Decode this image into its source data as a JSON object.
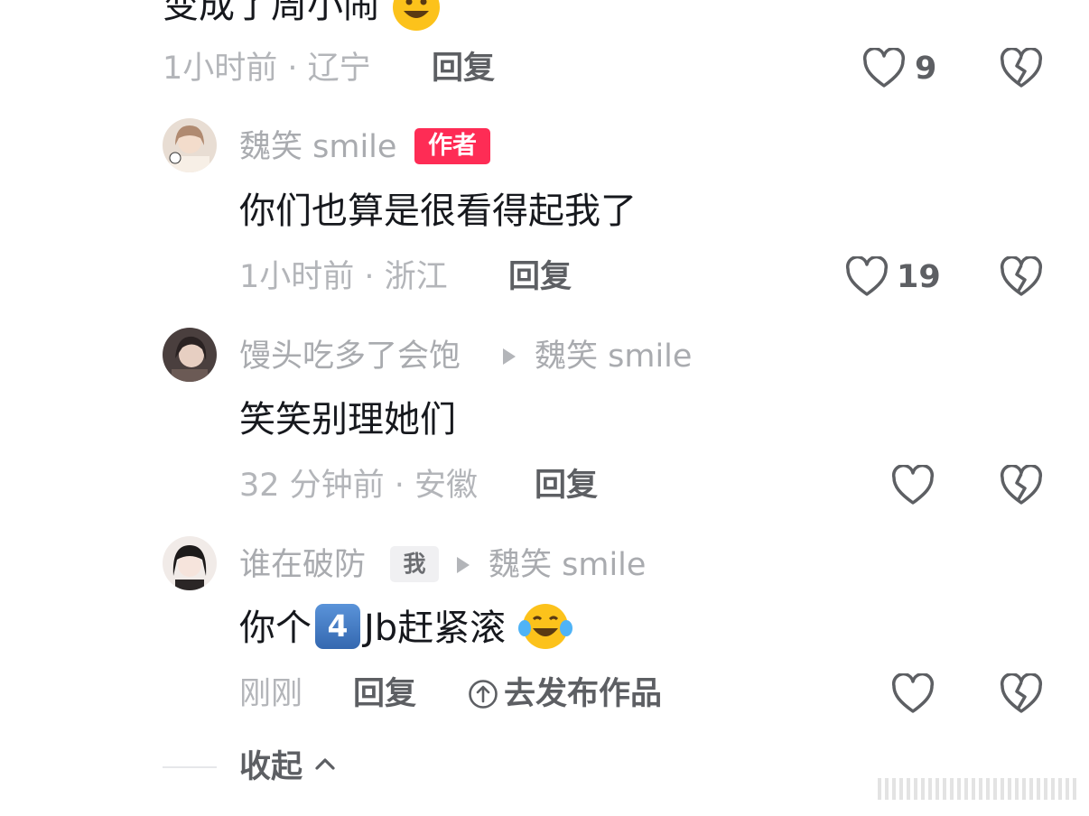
{
  "prev_comment": {
    "text_tail": "变成了周小闹",
    "time_loc": "1小时前 · 辽宁",
    "reply_label": "回复",
    "like_count": "9"
  },
  "comments": [
    {
      "username": "魏笑 smile",
      "badge": "作者",
      "text": "你们也算是很看得起我了",
      "time_loc": "1小时前 · 浙江",
      "reply_label": "回复",
      "like_count": "19"
    },
    {
      "username": "馒头吃多了会饱",
      "reply_to": "魏笑 smile",
      "text": "笑笑别理她们",
      "time_loc": "32 分钟前 · 安徽",
      "reply_label": "回复"
    },
    {
      "username": "谁在破防",
      "badge": "我",
      "reply_to": "魏笑 smile",
      "text_before": "你个",
      "keycap": "4",
      "text_after": "Jb赶紧滚",
      "time_loc": "刚刚",
      "reply_label": "回复",
      "publish_label": "去发布作品"
    }
  ],
  "collapse_label": "收起",
  "colors": {
    "author_badge": "#fe2c55",
    "meta_text": "#b3b5b9",
    "primary_text": "#16181d",
    "action_text": "#5d5f63"
  },
  "icons": [
    "heart-outline-icon",
    "broken-heart-icon",
    "play-triangle-icon",
    "upload-circle-icon",
    "chevron-up-icon",
    "grinning-emoji-icon",
    "crying-laughing-emoji-icon"
  ]
}
